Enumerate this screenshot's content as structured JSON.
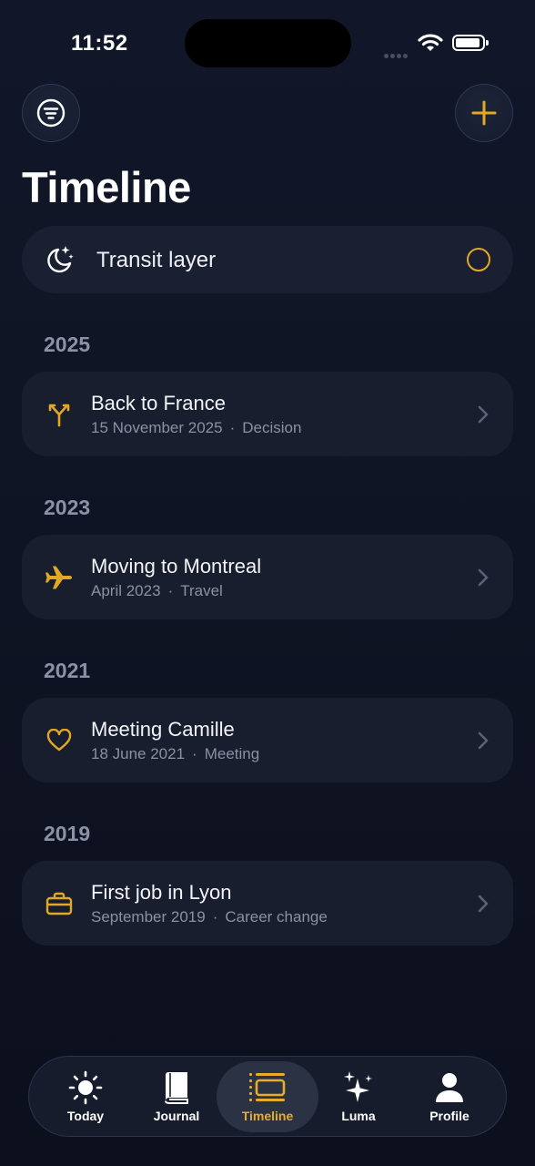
{
  "status_bar": {
    "time": "11:52"
  },
  "header": {
    "title": "Timeline",
    "filter_icon": "filter-icon",
    "add_icon": "plus-icon"
  },
  "transit": {
    "label": "Transit layer",
    "icon": "moon-stars-icon",
    "enabled": false
  },
  "sections": [
    {
      "year": "2025",
      "event": {
        "title": "Back to France",
        "date": "15 November 2025",
        "category": "Decision",
        "icon": "branch-icon"
      }
    },
    {
      "year": "2023",
      "event": {
        "title": "Moving to Montreal",
        "date": "April 2023",
        "category": "Travel",
        "icon": "airplane-icon"
      }
    },
    {
      "year": "2021",
      "event": {
        "title": "Meeting Camille",
        "date": "18 June 2021",
        "category": "Meeting",
        "icon": "heart-icon"
      }
    },
    {
      "year": "2019",
      "event": {
        "title": "First job in Lyon",
        "date": "September 2019",
        "category": "Career change",
        "icon": "briefcase-icon"
      }
    }
  ],
  "meta_separator": "·",
  "tabs": [
    {
      "label": "Today",
      "icon": "sun-icon",
      "active": false
    },
    {
      "label": "Journal",
      "icon": "book-icon",
      "active": false
    },
    {
      "label": "Timeline",
      "icon": "timeline-icon",
      "active": true
    },
    {
      "label": "Luma",
      "icon": "sparkles-icon",
      "active": false
    },
    {
      "label": "Profile",
      "icon": "person-icon",
      "active": false
    }
  ],
  "colors": {
    "accent": "#e3a823",
    "background": "#111728",
    "card": "#181e2e",
    "muted_text": "#8a91a2"
  }
}
